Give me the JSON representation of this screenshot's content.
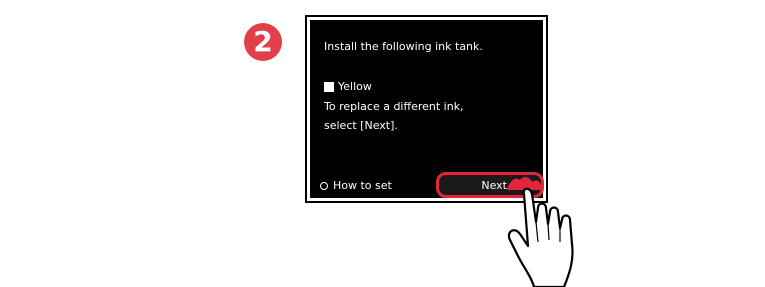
{
  "step": {
    "number": "2"
  },
  "screen": {
    "message": "Install the following ink tank.",
    "ink_name": "Yellow",
    "hint_line1": "To replace a different ink,",
    "hint_line2": "select [Next].",
    "how_to_label": "How to set",
    "next_label": "Next"
  },
  "colors": {
    "accent": "#e2263a",
    "badge": "#e23f4a",
    "screen_bg": "#000000"
  }
}
